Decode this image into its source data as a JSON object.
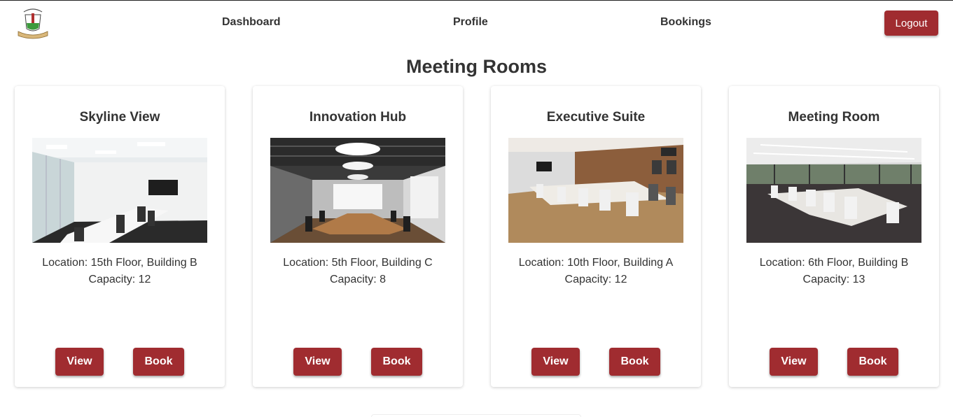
{
  "nav": {
    "dashboard": "Dashboard",
    "profile": "Profile",
    "bookings": "Bookings",
    "logout": "Logout"
  },
  "page": {
    "title": "Meeting Rooms"
  },
  "rooms": [
    {
      "name": "Skyline View",
      "location": "Location: 15th Floor, Building B",
      "capacity": "Capacity: 12",
      "view": "View",
      "book": "Book"
    },
    {
      "name": "Innovation Hub",
      "location": "Location: 5th Floor, Building C",
      "capacity": "Capacity: 8",
      "view": "View",
      "book": "Book"
    },
    {
      "name": "Executive Suite",
      "location": "Location: 10th Floor, Building A",
      "capacity": "Capacity: 12",
      "view": "View",
      "book": "Book"
    },
    {
      "name": "Meeting Room",
      "location": "Location: 6th Floor, Building B",
      "capacity": "Capacity: 13",
      "view": "View",
      "book": "Book"
    }
  ],
  "colors": {
    "accent": "#a02c30",
    "text": "#333333"
  }
}
